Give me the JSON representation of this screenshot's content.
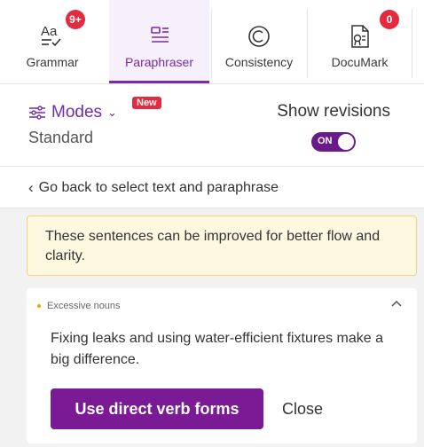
{
  "tabs": [
    {
      "label": "Grammar",
      "icon": "grammar-icon",
      "badge": "9+"
    },
    {
      "label": "Paraphraser",
      "icon": "paraphraser-icon",
      "active": true
    },
    {
      "label": "Consistency",
      "icon": "consistency-icon"
    },
    {
      "label": "DocuMark",
      "icon": "documark-icon",
      "badge": "0"
    }
  ],
  "modes": {
    "label": "Modes",
    "new_badge": "New",
    "current": "Standard",
    "show_revisions_label": "Show revisions",
    "toggle_text": "ON"
  },
  "nav": {
    "go_back": "Go back to select text and paraphrase"
  },
  "notice": {
    "text": "These sentences can be improved for better flow and clarity."
  },
  "suggestion": {
    "category": "Excessive nouns",
    "sentence": "Fixing leaks and using water-efficient fixtures make a big difference.",
    "apply_label": "Use direct verb forms",
    "close_label": "Close"
  },
  "colors": {
    "accent": "#7a1a94",
    "badge": "#e5293e",
    "notice_bg": "#fff8e1",
    "notice_border": "#f2d27a",
    "category_dot": "#f0a500"
  }
}
